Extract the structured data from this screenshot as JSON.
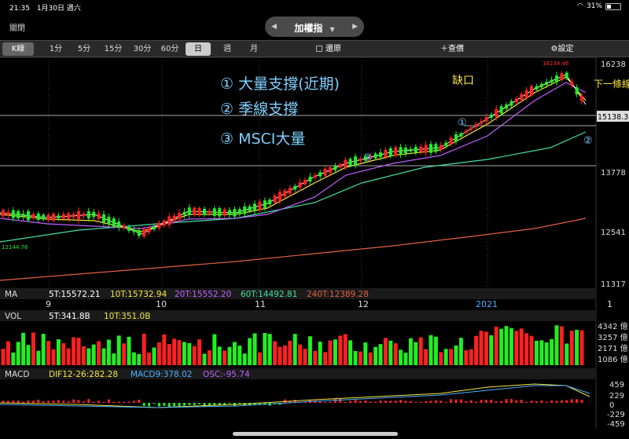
{
  "status_bar": {
    "time": "21:35",
    "date": "1月30日 週六",
    "battery": "31%"
  },
  "nav": {
    "close": "關閉",
    "title": "加權指",
    "prev_arrow": "◀",
    "next_arrow": "▶",
    "dropdown": "▼"
  },
  "toolbar": {
    "periods": [
      "K線",
      "1分",
      "5分",
      "15分",
      "30分",
      "60分",
      "日",
      "週",
      "月"
    ],
    "restore_label": "還原",
    "query_label": "查價",
    "settings_label": "設定"
  },
  "price_axis": {
    "top": "16238",
    "highlight": "15138.31",
    "mid1": "13778",
    "mid2": "12541",
    "bottom": "11317"
  },
  "price_annotations": {
    "high_marker": "16238.46",
    "low_marker": "12144.76"
  },
  "handwriting": {
    "note1": "① 大量支撐(近期)",
    "note2": "② 季線支撐",
    "note3": "③ MSCI大量",
    "gap": "缺口",
    "below": "下一條線",
    "circle1": "①",
    "circle2": "②",
    "circle3": "③"
  },
  "ma_panel": {
    "label": "MA",
    "ma5": "5T:15572.21",
    "ma10": "10T:15732.94",
    "ma20": "20T:15552.20",
    "ma60": "60T:14492.81",
    "ma240": "240T:12389.28"
  },
  "x_axis": [
    "9",
    "10",
    "11",
    "12",
    "2021",
    "1"
  ],
  "vol_panel": {
    "label": "VOL",
    "v5": "5T:341.8B",
    "v10": "10T:351.0B",
    "axis": [
      "4342 億",
      "3257 億",
      "2171 億",
      "1086 億"
    ]
  },
  "macd_panel": {
    "label": "MACD",
    "dif": "DIF12-26:282.28",
    "macd": "MACD9:378.02",
    "osc": "OSC:-95.74",
    "axis": [
      "459",
      "229",
      "0",
      "-229",
      "-459"
    ]
  },
  "colors": {
    "up": "#ff2020",
    "down": "#22ee22",
    "ma5": "#ffffff",
    "ma10": "#f5e642",
    "ma20": "#c060ff",
    "ma60": "#40e0a0",
    "ma240": "#e06040"
  },
  "chart_data": {
    "type": "candlestick",
    "period": "daily",
    "series_levels": {
      "high": 16238.46,
      "low": 12144.76,
      "last_close_marker": 15138.31
    },
    "y_ticks": [
      16238,
      13778,
      12541,
      11317
    ]
  }
}
